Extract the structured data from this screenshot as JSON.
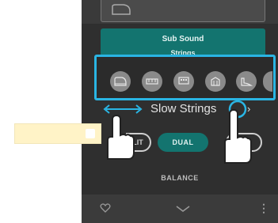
{
  "sub_sound": {
    "title": "Sub Sound",
    "name": "Strings"
  },
  "instrument_bar": {
    "icons": [
      "grand-piano-icon",
      "electric-piano-icon",
      "organ-icon",
      "harpsichord-icon",
      "strings-icon",
      "more-icon"
    ]
  },
  "instrument": {
    "name": "Slow Strings",
    "next_label": "›"
  },
  "tooltip": {
    "text": ""
  },
  "modes": {
    "split_label": "LIT",
    "dual_label": "DUAL"
  },
  "balance": {
    "label": "BALANCE"
  },
  "bottom": {
    "more_label": "⋮"
  },
  "colors": {
    "accent": "#13746f",
    "highlight": "#2ab5e3",
    "tooltip": "#fff3c7"
  }
}
